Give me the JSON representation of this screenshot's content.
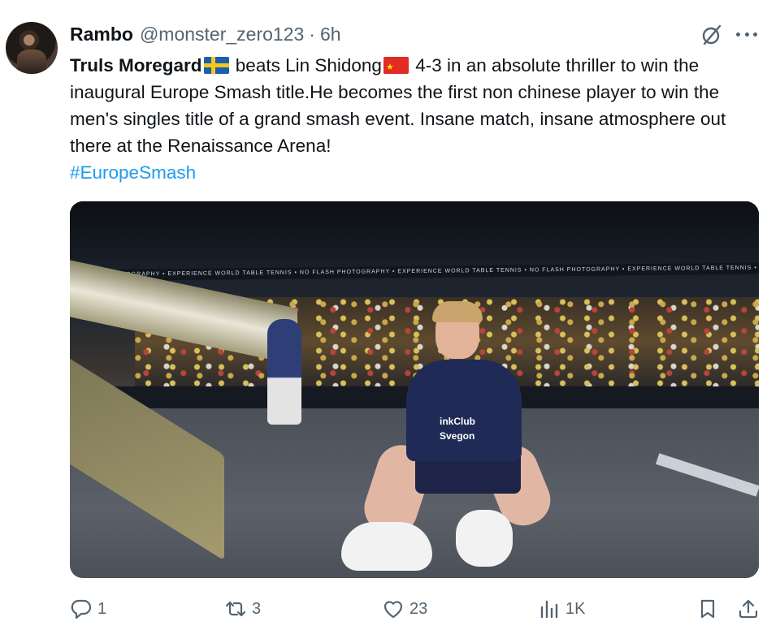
{
  "author": {
    "display_name": "Rambo",
    "handle": "@monster_zero123",
    "separator": "·",
    "time": "6h"
  },
  "tweet": {
    "lead_name": "Truls Moregard",
    "text_1": " beats Lin Shidong",
    "text_2": " 4-3 in an absolute thriller to win the inaugural Europe Smash title.He becomes the first non chinese player to win the men's singles title of a grand smash event. Insane match, insane atmosphere out there at the Renaissance Arena!",
    "hashtag": "#EuropeSmash"
  },
  "media": {
    "banner_text": "NO FLASH PHOTOGRAPHY  •  EXPERIENCE WORLD TABLE TENNIS  •  NO FLASH PHOTOGRAPHY  •  EXPERIENCE WORLD TABLE TENNIS  •  NO FLASH PHOTOGRAPHY  •  EXPERIENCE WORLD TABLE TENNIS  •  NO FLASH PHOTOGRAPHY",
    "shirt_line_1": "inkClub",
    "shirt_line_2": "Svegon"
  },
  "actions": {
    "replies": "1",
    "reposts": "3",
    "likes": "23",
    "views": "1K"
  },
  "icons": {
    "reply": "reply-icon",
    "repost": "repost-icon",
    "like": "heart-icon",
    "views": "views-icon",
    "bookmark": "bookmark-icon",
    "share": "share-icon",
    "grok": "grok-icon",
    "more": "more-icon"
  },
  "colors": {
    "text": "#0f1419",
    "secondary": "#536471",
    "link": "#1d9bf0"
  }
}
